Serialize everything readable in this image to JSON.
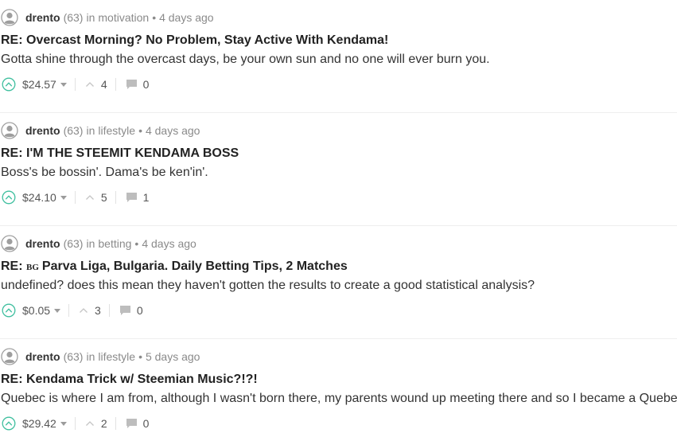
{
  "posts": [
    {
      "author": "drento",
      "reputation": "(63)",
      "in_word": "in",
      "category": "motivation",
      "separator": "•",
      "time": "4 days ago",
      "flag": "",
      "title": "RE: Overcast Morning? No Problem, Stay Active With Kendama!",
      "body": "Gotta shine through the overcast days, be your own sun and no one will ever burn you.",
      "payout": "$24.57",
      "votes": "4",
      "comments": "0"
    },
    {
      "author": "drento",
      "reputation": "(63)",
      "in_word": "in",
      "category": "lifestyle",
      "separator": "•",
      "time": "4 days ago",
      "flag": "",
      "title": "RE: I'M THE STEEMIT KENDAMA BOSS",
      "body": "Boss's be bossin'. Dama's be ken'in'.",
      "payout": "$24.10",
      "votes": "5",
      "comments": "1"
    },
    {
      "author": "drento",
      "reputation": "(63)",
      "in_word": "in",
      "category": "betting",
      "separator": "•",
      "time": "4 days ago",
      "title_prefix": "RE:",
      "flag": "BG",
      "title": "Parva Liga, Bulgaria. Daily Betting Tips, 2 Matches",
      "body": "undefined? does this mean they haven't gotten the results to create a good statistical analysis?",
      "payout": "$0.05",
      "votes": "3",
      "comments": "0"
    },
    {
      "author": "drento",
      "reputation": "(63)",
      "in_word": "in",
      "category": "lifestyle",
      "separator": "•",
      "time": "5 days ago",
      "flag": "",
      "title": "RE: Kendama Trick w/ Steemian Music?!?!",
      "body": "Quebec is where I am from, although I wasn't born there, my parents wound up meeting there and so I became a Quebe",
      "payout": "$29.42",
      "votes": "2",
      "comments": "0"
    }
  ],
  "icons": {
    "avatar": "user-avatar-icon",
    "upvote": "upvote-circle-chevron-icon",
    "votes": "chevron-up-icon",
    "comments": "speech-bubble-icon",
    "caret": "caret-down-icon"
  },
  "colors": {
    "upvote_accent": "#4ba2f2",
    "upvote_teal": "#3fbf9f",
    "muted": "#8a8a8a",
    "divider": "#eeeeee"
  }
}
